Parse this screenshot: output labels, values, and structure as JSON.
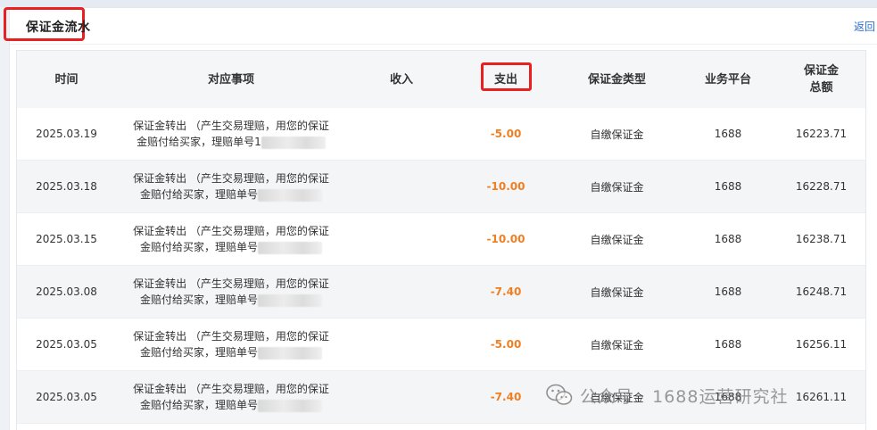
{
  "header": {
    "title": "保证金流水",
    "back_label": "返回"
  },
  "table": {
    "columns": [
      "时间",
      "对应事项",
      "收入",
      "支出",
      "保证金类型",
      "业务平台",
      "保证金",
      "总额"
    ],
    "rows": [
      {
        "date": "2025.03.19",
        "desc_line1": "保证金转出 （产生交易理赔，用您的保证",
        "desc_line2": "金赔付给买家，理赔单号1",
        "income": "",
        "expense": "-5.00",
        "type": "自缴保证金",
        "platform": "1688",
        "total": "16223.71"
      },
      {
        "date": "2025.03.18",
        "desc_line1": "保证金转出 （产生交易理赔，用您的保证",
        "desc_line2": "金赔付给买家，理赔单号",
        "income": "",
        "expense": "-10.00",
        "type": "自缴保证金",
        "platform": "1688",
        "total": "16228.71"
      },
      {
        "date": "2025.03.15",
        "desc_line1": "保证金转出 （产生交易理赔，用您的保证",
        "desc_line2": "金赔付给买家，理赔单号",
        "income": "",
        "expense": "-10.00",
        "type": "自缴保证金",
        "platform": "1688",
        "total": "16238.71"
      },
      {
        "date": "2025.03.08",
        "desc_line1": "保证金转出 （产生交易理赔，用您的保证",
        "desc_line2": "金赔付给买家，理赔单号",
        "income": "",
        "expense": "-7.40",
        "type": "自缴保证金",
        "platform": "1688",
        "total": "16248.71"
      },
      {
        "date": "2025.03.05",
        "desc_line1": "保证金转出 （产生交易理赔，用您的保证",
        "desc_line2": "金赔付给买家，理赔单号",
        "income": "",
        "expense": "-5.00",
        "type": "自缴保证金",
        "platform": "1688",
        "total": "16256.11"
      },
      {
        "date": "2025.03.05",
        "desc_line1": "保证金转出 （产生交易理赔，用您的保证",
        "desc_line2": "金赔付给买家，理赔单号",
        "income": "",
        "expense": "-7.40",
        "type": "自缴保证金",
        "platform": "1688",
        "total": "16261.11"
      }
    ]
  },
  "watermark": {
    "text": "公众号 · 1688运营研究社",
    "icon": "wechat-icon"
  },
  "colors": {
    "accent_red": "#e8201f",
    "expense_orange": "#f07f22",
    "link_blue": "#2a6fd6"
  }
}
